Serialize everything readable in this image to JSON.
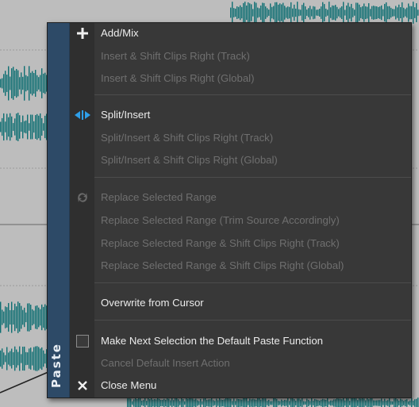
{
  "side_label": "Paste",
  "items": [
    {
      "label": "Add/Mix",
      "icon": "plus-icon",
      "enabled": true
    },
    {
      "label": "Insert & Shift Clips Right (Track)",
      "enabled": false
    },
    {
      "label": "Insert & Shift Clips Right (Global)",
      "enabled": false
    },
    {
      "label": "Split/Insert",
      "icon": "split-insert-icon",
      "enabled": true
    },
    {
      "label": "Split/Insert & Shift Clips Right (Track)",
      "enabled": false
    },
    {
      "label": "Split/Insert & Shift Clips Right (Global)",
      "enabled": false
    },
    {
      "label": "Replace Selected Range",
      "icon": "replace-icon",
      "enabled": false
    },
    {
      "label": "Replace Selected Range (Trim Source Accordingly)",
      "enabled": false
    },
    {
      "label": "Replace Selected Range & Shift Clips Right (Track)",
      "enabled": false
    },
    {
      "label": "Replace Selected Range & Shift Clips Right (Global)",
      "enabled": false
    },
    {
      "label": "Overwrite from Cursor",
      "enabled": true
    },
    {
      "label": "Make Next Selection the Default Paste Function",
      "icon": "checkbox-icon",
      "checked": false,
      "enabled": true
    },
    {
      "label": "Cancel Default Insert Action",
      "enabled": false
    },
    {
      "label": "Close Menu",
      "icon": "close-icon",
      "enabled": true
    }
  ],
  "colors": {
    "menu_bg": "#383838",
    "side_strip": "#2d4a67",
    "waveform": "#0f6f73",
    "accent_blue": "#2f9fe8"
  }
}
